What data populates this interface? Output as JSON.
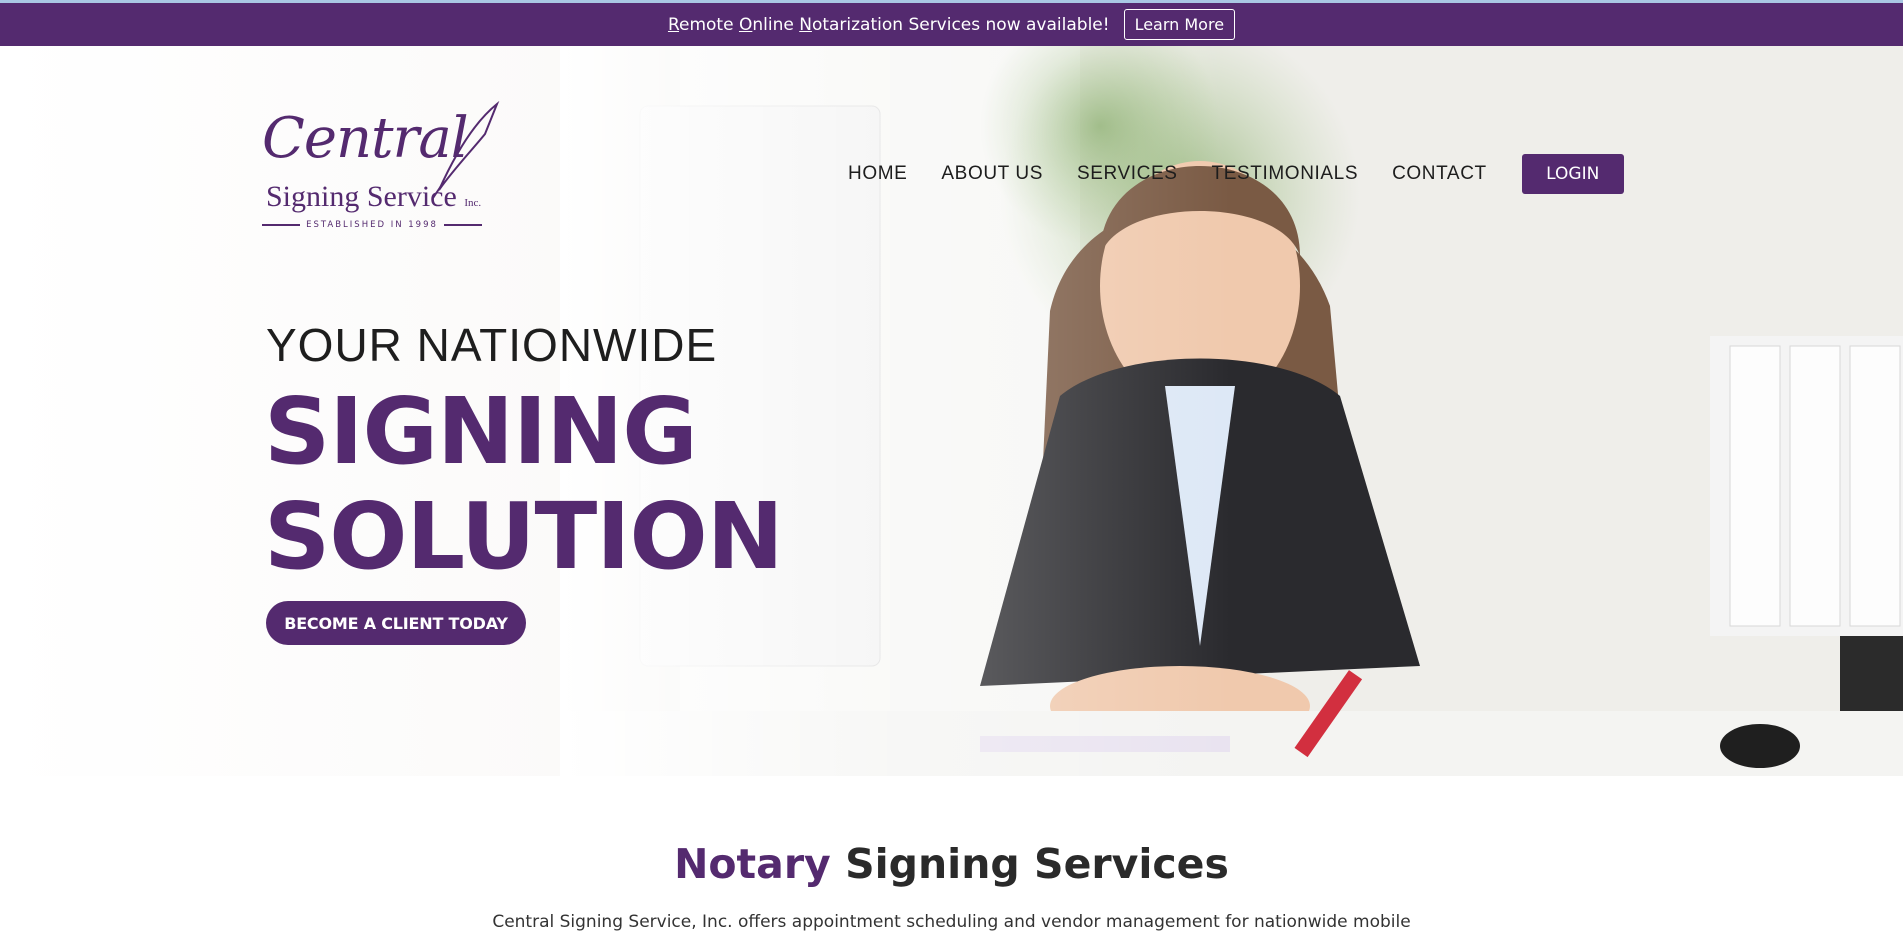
{
  "announcement": {
    "text_parts": [
      {
        "u": "R",
        "t": "emote "
      },
      {
        "u": "O",
        "t": "nline "
      },
      {
        "u": "N",
        "t": "otarization Services now available!"
      }
    ],
    "button_label": "Learn More"
  },
  "logo": {
    "script": "Central",
    "sub": "Signing Service",
    "inc": "Inc.",
    "established": "ESTABLISHED IN 1998"
  },
  "nav": {
    "items": [
      "HOME",
      "ABOUT US",
      "SERVICES",
      "TESTIMONIALS",
      "CONTACT"
    ],
    "login_label": "LOGIN"
  },
  "hero": {
    "kicker": "YOUR NATIONWIDE",
    "line1": "SIGNING",
    "line2": "SOLUTION",
    "cta_label": "BECOME A CLIENT TODAY"
  },
  "section": {
    "title_accent": "Notary",
    "title_rest": "Signing Services",
    "intro": "Central Signing Service, Inc. offers appointment scheduling and vendor management for nationwide mobile"
  },
  "colors": {
    "brand_purple": "#542a6f",
    "top_line": "#a9c7e3"
  }
}
